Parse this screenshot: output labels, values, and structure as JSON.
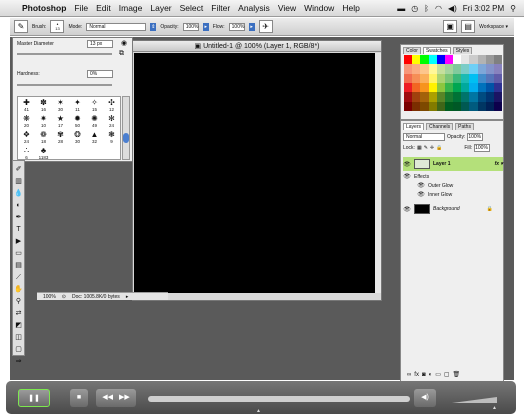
{
  "menubar": {
    "apple": "",
    "items": [
      "Photoshop",
      "File",
      "Edit",
      "Image",
      "Layer",
      "Select",
      "Filter",
      "Analysis",
      "View",
      "Window",
      "Help"
    ],
    "clock": "Fri 3:02 PM"
  },
  "options": {
    "brush_label": "Brush:",
    "brush_size": "13",
    "mode_label": "Mode:",
    "mode_value": "Normal",
    "opacity_label": "Opacity:",
    "opacity_value": "100%",
    "flow_label": "Flow:",
    "flow_value": "100%",
    "workspace_label": "Workspace ▾"
  },
  "brushpicker": {
    "diameter_label": "Master Diameter",
    "diameter_value": "13 px",
    "hardness_label": "Hardness:",
    "hardness_value": "0%",
    "brushes": [
      {
        "glyph": "✚",
        "size": "41"
      },
      {
        "glyph": "✽",
        "size": "16"
      },
      {
        "glyph": "✶",
        "size": "30"
      },
      {
        "glyph": "✦",
        "size": "11"
      },
      {
        "glyph": "✧",
        "size": "15"
      },
      {
        "glyph": "✣",
        "size": "12"
      },
      {
        "glyph": "❋",
        "size": "20"
      },
      {
        "glyph": "✷",
        "size": "10"
      },
      {
        "glyph": "★",
        "size": "17"
      },
      {
        "glyph": "✹",
        "size": "50"
      },
      {
        "glyph": "✺",
        "size": "49"
      },
      {
        "glyph": "✻",
        "size": "24"
      },
      {
        "glyph": "❖",
        "size": "24"
      },
      {
        "glyph": "❁",
        "size": "18"
      },
      {
        "glyph": "✾",
        "size": "28"
      },
      {
        "glyph": "❂",
        "size": "30"
      },
      {
        "glyph": "▲",
        "size": "32"
      },
      {
        "glyph": "❃",
        "size": "9"
      },
      {
        "glyph": "∴",
        "size": "6"
      },
      {
        "glyph": "♣",
        "size": "1183"
      }
    ]
  },
  "document": {
    "title": "Untitled-1 @ 100% (Layer 1, RGB/8*)",
    "zoom": "100%",
    "doc_info": "Doc: 1005.8K/0 bytes"
  },
  "swatches": {
    "tabs": [
      "Color",
      "Swatches",
      "Styles"
    ],
    "colors": [
      "#ff0000",
      "#ffff00",
      "#00ff00",
      "#00ffff",
      "#0000ff",
      "#ff00ff",
      "#ffffff",
      "#e6e6e6",
      "#cccccc",
      "#b3b3b3",
      "#999999",
      "#808080",
      "#f7977a",
      "#fbad82",
      "#fdc68c",
      "#fff799",
      "#c6df9c",
      "#a4d49d",
      "#81ca9d",
      "#7bcdc8",
      "#6ecff6",
      "#7ea7d8",
      "#8493ca",
      "#8882be",
      "#f26c4f",
      "#f68e56",
      "#fbaf5a",
      "#fff467",
      "#acd372",
      "#7cc576",
      "#3bb878",
      "#1abbb4",
      "#00bff3",
      "#438ccb",
      "#5574b9",
      "#605ca9",
      "#ed1c24",
      "#f26522",
      "#f7941d",
      "#fff200",
      "#8dc63f",
      "#39b54a",
      "#00a651",
      "#00a99d",
      "#00aeef",
      "#0072bc",
      "#0054a6",
      "#2e3192",
      "#9e0b0f",
      "#a0410d",
      "#a3620a",
      "#aba000",
      "#598527",
      "#1a7b30",
      "#007236",
      "#00746b",
      "#0076a3",
      "#004b80",
      "#003471",
      "#1b1464",
      "#790000",
      "#7b2e00",
      "#7d4900",
      "#827b00",
      "#406618",
      "#005e20",
      "#005826",
      "#005952",
      "#005b7f",
      "#003663",
      "#002157",
      "#0d004c"
    ]
  },
  "layers": {
    "tabs": [
      "Layers",
      "Channels",
      "Paths"
    ],
    "blend_mode": "Normal",
    "opacity_label": "Opacity:",
    "opacity_value": "100%",
    "lock_label": "Lock:",
    "fill_label": "Fill:",
    "fill_value": "100%",
    "items": [
      {
        "name": "Layer 1",
        "fx": "fx ▾"
      },
      {
        "name": "Effects"
      },
      {
        "name": "Outer Glow"
      },
      {
        "name": "Inner Glow"
      },
      {
        "name": "Background"
      }
    ]
  }
}
